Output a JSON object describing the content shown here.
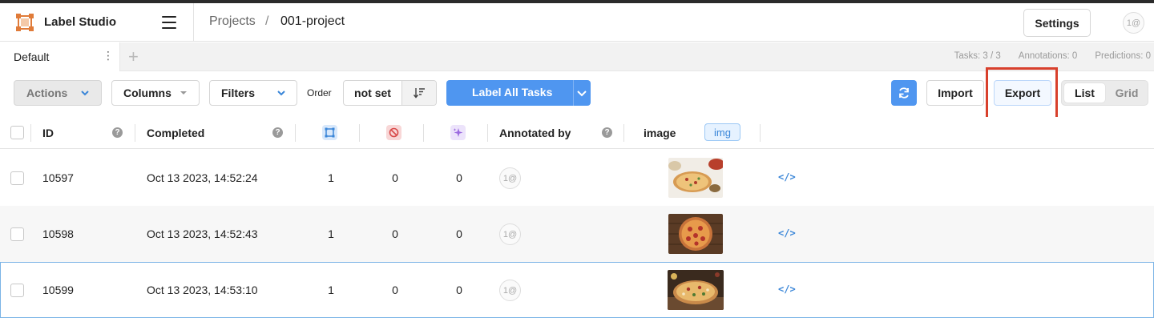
{
  "header": {
    "app_title": "Label Studio",
    "breadcrumb_root": "Projects",
    "breadcrumb_separator": "/",
    "breadcrumb_current": "001-project",
    "settings_label": "Settings",
    "avatar_initials": "1@"
  },
  "tabs": {
    "items": [
      {
        "label": "Default",
        "menu_glyph": "⋮"
      }
    ],
    "add_glyph": "+"
  },
  "stats": {
    "tasks": "Tasks: 3 / 3",
    "annotations": "Annotations: 0",
    "predictions": "Predictions: 0"
  },
  "toolbar": {
    "actions_label": "Actions",
    "columns_label": "Columns",
    "filters_label": "Filters",
    "order_label": "Order",
    "order_value": "not set",
    "label_all_label": "Label All Tasks",
    "import_label": "Import",
    "export_label": "Export",
    "view_list_label": "List",
    "view_grid_label": "Grid",
    "accent_color": "#4f96f0",
    "highlight_color": "#d8402c"
  },
  "table": {
    "columns": {
      "id": "ID",
      "completed": "Completed",
      "annotated_by": "Annotated by",
      "image": "image",
      "image_badge": "img",
      "help_glyph": "?",
      "total_annotations_icon": "annotations-icon",
      "cancelled_icon": "cancelled-icon",
      "predictions_icon": "predictions-icon"
    },
    "rows": [
      {
        "id": "10597",
        "completed": "Oct 13 2023, 14:52:24",
        "total": "1",
        "cancelled": "0",
        "predictions": "0",
        "annotator": "1@",
        "source_glyph": "</>"
      },
      {
        "id": "10598",
        "completed": "Oct 13 2023, 14:52:43",
        "total": "1",
        "cancelled": "0",
        "predictions": "0",
        "annotator": "1@",
        "source_glyph": "</>"
      },
      {
        "id": "10599",
        "completed": "Oct 13 2023, 14:53:10",
        "total": "1",
        "cancelled": "0",
        "predictions": "0",
        "annotator": "1@",
        "source_glyph": "</>"
      }
    ]
  }
}
